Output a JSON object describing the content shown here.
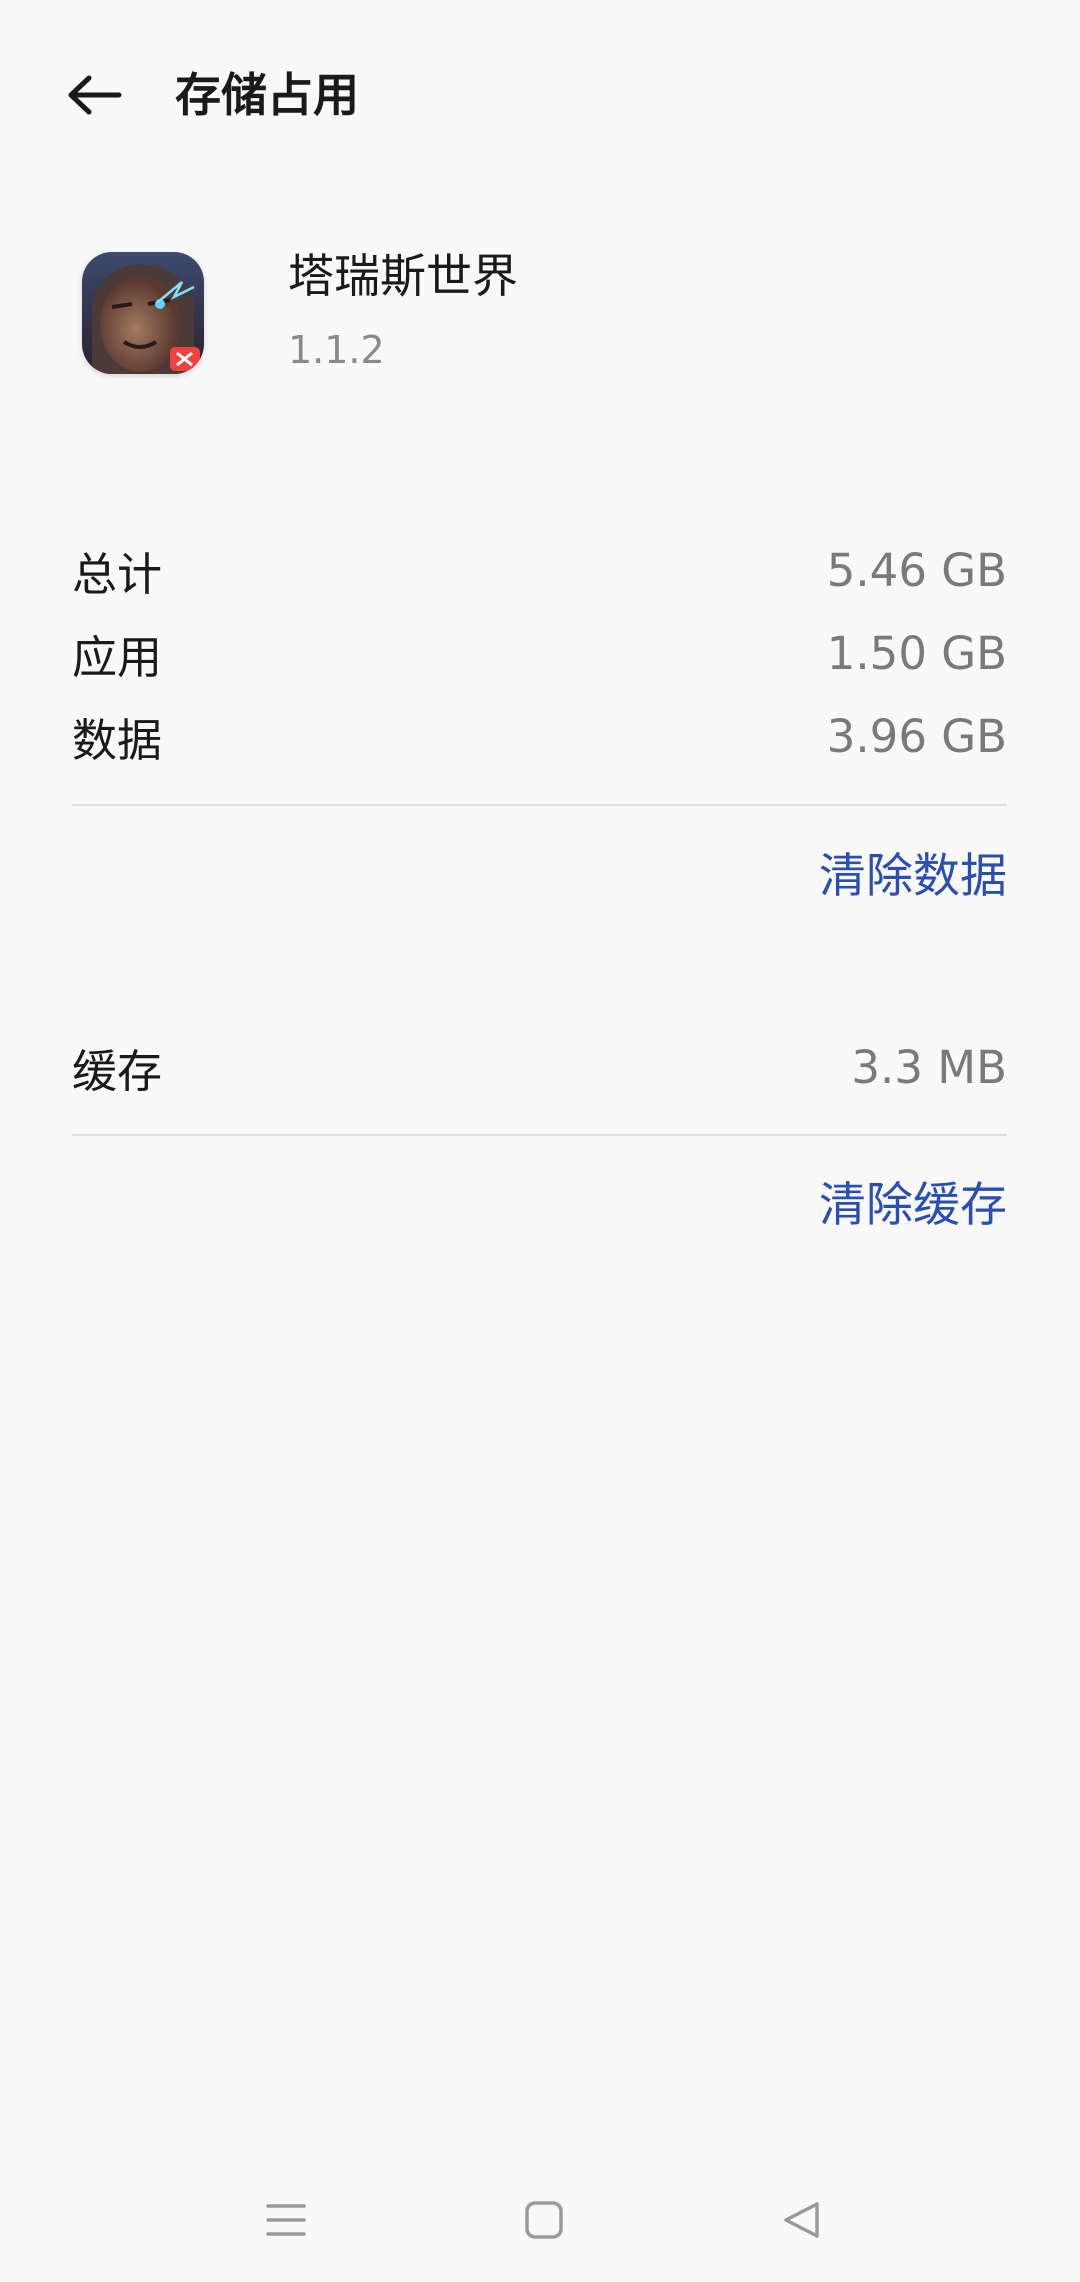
{
  "header": {
    "title": "存储占用"
  },
  "app": {
    "name": "塔瑞斯世界",
    "version": "1.1.2"
  },
  "storage": {
    "total_label": "总计",
    "total_value": "5.46 GB",
    "app_label": "应用",
    "app_value": "1.50 GB",
    "data_label": "数据",
    "data_value": "3.96 GB",
    "clear_data_label": "清除数据"
  },
  "cache": {
    "label": "缓存",
    "value": "3.3 MB",
    "clear_cache_label": "清除缓存"
  },
  "icons": {
    "back": "arrow-left-icon",
    "menu": "menu-icon",
    "home": "square-icon",
    "back_nav": "triangle-back-icon"
  },
  "colors": {
    "accent": "#2a4fb0",
    "background": "#f9f9f9",
    "text_primary": "#1a1a1a",
    "text_secondary": "#7a7a7a"
  }
}
